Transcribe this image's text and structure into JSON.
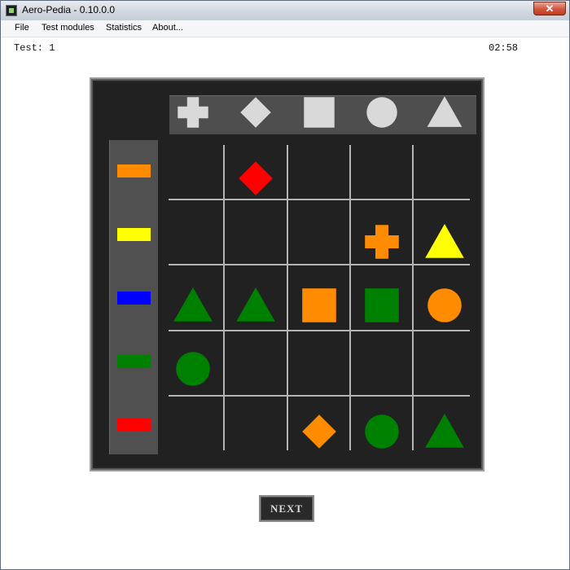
{
  "window": {
    "title": "Aero-Pedia - 0.10.0.0",
    "close_label": "✕"
  },
  "menu": {
    "items": [
      "File",
      "Test modules",
      "Statistics",
      "About..."
    ]
  },
  "status": {
    "test_label": "Test: 1",
    "timer": "02:58"
  },
  "header_shapes": [
    "cross",
    "diamond",
    "square",
    "circle",
    "triangle"
  ],
  "color_column": [
    "#ff8c00",
    "#ffff00",
    "#0000ff",
    "#008000",
    "#ff0000"
  ],
  "grid": [
    [
      null,
      {
        "shape": "diamond",
        "color": "#ff0000"
      },
      null,
      null,
      null
    ],
    [
      null,
      null,
      null,
      {
        "shape": "cross",
        "color": "#ff8c00"
      },
      {
        "shape": "triangle",
        "color": "#ffff00"
      }
    ],
    [
      {
        "shape": "triangle",
        "color": "#008000"
      },
      {
        "shape": "triangle",
        "color": "#008000"
      },
      {
        "shape": "square",
        "color": "#ff8c00"
      },
      {
        "shape": "square",
        "color": "#008000"
      },
      {
        "shape": "circle",
        "color": "#ff8c00"
      }
    ],
    [
      {
        "shape": "circle",
        "color": "#008000"
      },
      null,
      null,
      null,
      null
    ],
    [
      null,
      null,
      {
        "shape": "diamond",
        "color": "#ff8c00"
      },
      {
        "shape": "circle",
        "color": "#008000"
      },
      {
        "shape": "triangle",
        "color": "#008000"
      }
    ]
  ],
  "header_shape_color": "#d9d9d9",
  "grid_line_color": "#b4b4b4",
  "next_button_label": "NEXT"
}
